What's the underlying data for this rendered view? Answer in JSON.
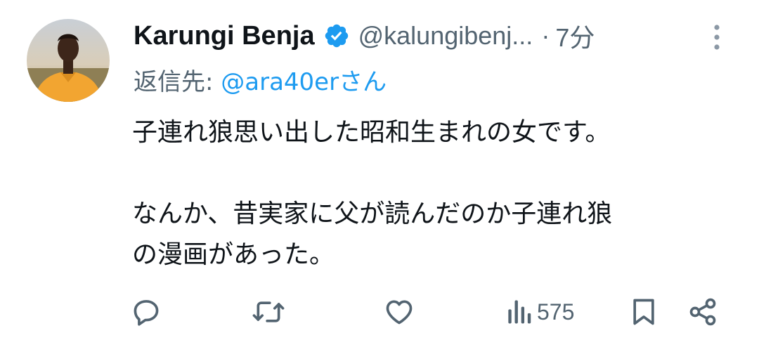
{
  "tweet": {
    "author_name": "Karungi Benja",
    "author_handle": "@kalungibenj...",
    "separator": "·",
    "time": "7分",
    "reply_prefix": "返信先: ",
    "reply_to": "@ara40erさん",
    "body_lines": [
      "子連れ狼思い出した昭和生まれの女です。",
      "",
      "なんか、昔実家に父が読んだのか子連れ狼",
      "の漫画があった。"
    ],
    "views": "575"
  },
  "icons": {
    "verified": "verified-badge-icon",
    "more": "more-vertical-icon",
    "reply": "reply-icon",
    "retweet": "retweet-icon",
    "like": "like-heart-icon",
    "views": "views-bar-chart-icon",
    "bookmark": "bookmark-icon",
    "share": "share-icon"
  },
  "colors": {
    "verified": "#1d9bf0",
    "mention": "#1d9bf0",
    "secondary_text": "#536471",
    "primary_text": "#0f1419"
  }
}
